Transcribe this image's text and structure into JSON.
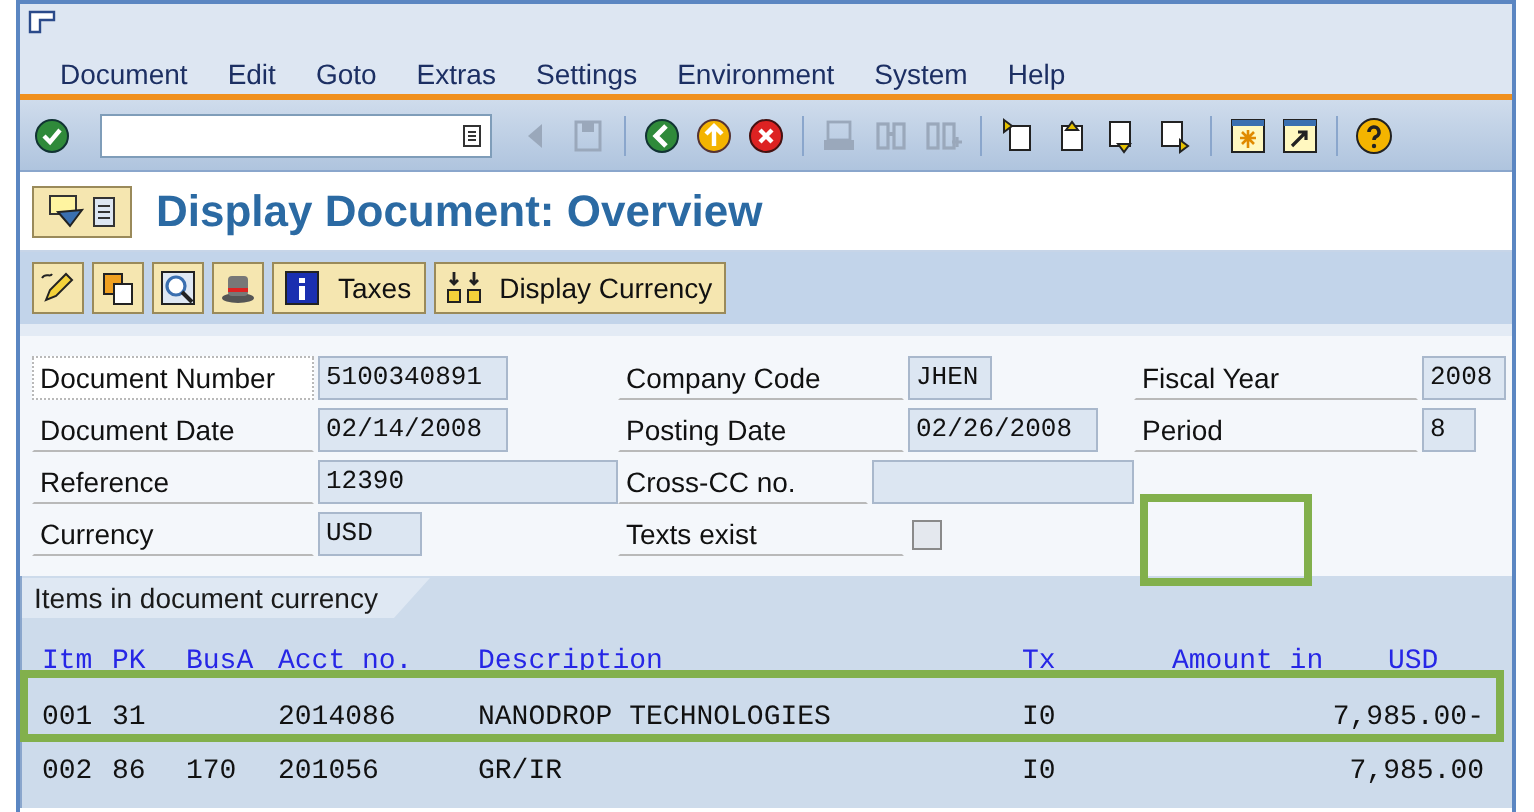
{
  "menu": [
    "Document",
    "Edit",
    "Goto",
    "Extras",
    "Settings",
    "Environment",
    "System",
    "Help"
  ],
  "title": "Display Document: Overview",
  "app_toolbar": [
    {
      "kind": "icon"
    },
    {
      "kind": "icon"
    },
    {
      "kind": "icon"
    },
    {
      "kind": "icon"
    },
    {
      "kind": "labeled",
      "label": "Taxes"
    },
    {
      "kind": "labeled",
      "label": "Display Currency"
    }
  ],
  "header_fields": [
    [
      {
        "label": "Document Number",
        "value": "5100340891",
        "kind": "text",
        "focused": true
      },
      {
        "label": "Document Date",
        "value": "02/14/2008",
        "kind": "text",
        "focused": false
      },
      {
        "label": "Reference",
        "value": "12390",
        "kind": "text",
        "focused": false
      },
      {
        "label": "Currency",
        "value": "USD",
        "kind": "text",
        "focused": false
      }
    ],
    [
      {
        "label": "Company Code",
        "value": "JHEN",
        "kind": "text",
        "focused": false
      },
      {
        "label": "Posting Date",
        "value": "02/26/2008",
        "kind": "text",
        "focused": false
      },
      {
        "label": "Cross-CC no.",
        "kind": "text",
        "focused": false
      },
      {
        "label": "Texts exist",
        "kind": "checkbox",
        "checked": false,
        "focused": false
      }
    ],
    [
      {
        "label": "Fiscal Year",
        "value": "2008",
        "kind": "text",
        "focused": false
      },
      {
        "label": "Period",
        "value": "8",
        "kind": "text",
        "focused": false
      }
    ]
  ],
  "items": {
    "tab": "Items in document currency",
    "columns": [
      "Itm",
      "PK",
      "BusA",
      "Acct no.",
      "Description",
      "Tx",
      "Amount in",
      "USD"
    ],
    "rows": [
      {
        "cells": [
          "001",
          "31",
          "",
          "2014086",
          "NANODROP TECHNOLOGIES",
          "I0",
          "7,985.00-"
        ]
      },
      {
        "cells": [
          "002",
          "86",
          "170",
          "201056",
          "GR/IR",
          "I0",
          "7,985.00"
        ]
      }
    ]
  }
}
